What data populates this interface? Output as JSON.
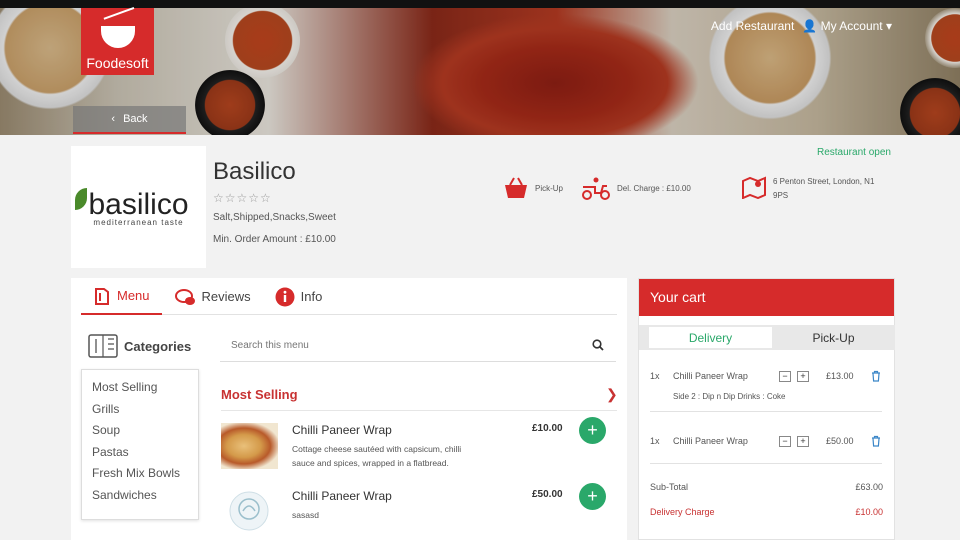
{
  "header": {
    "logo_text": "Foodesoft",
    "add_restaurant": "Add Restaurant",
    "my_account": "My Account",
    "back": "Back"
  },
  "restaurant": {
    "name": "Basilico",
    "logo_wordmark": "basilico",
    "logo_tagline": "mediterranean taste",
    "rating": 0,
    "stars": "☆☆☆☆☆",
    "cuisines": "Salt,Shipped,Snacks,Sweet",
    "min_order": "Min. Order Amount :  £10.00",
    "status": "Restaurant open",
    "pickup_label": "Pick-Up",
    "delivery_charge": "Del. Charge : £10.00",
    "address": "6 Penton Street, London, N1 9PS"
  },
  "tabs": [
    {
      "label": "Menu",
      "active": true
    },
    {
      "label": "Reviews",
      "active": false
    },
    {
      "label": "Info",
      "active": false
    }
  ],
  "categories": {
    "title": "Categories",
    "items": [
      "Most Selling",
      "Grills",
      "Soup",
      "Pastas",
      "Fresh Mix Bowls",
      "Sandwiches"
    ]
  },
  "search": {
    "placeholder": "Search this menu"
  },
  "section": {
    "title": "Most Selling"
  },
  "menu_items": [
    {
      "name": "Chilli Paneer Wrap",
      "description": "Cottage cheese sautéed with capsicum, chilli sauce and spices, wrapped in a flatbread.",
      "price": "£10.00",
      "add": "+"
    },
    {
      "name": "Chilli Paneer Wrap",
      "description": "sasasd",
      "price": "£50.00",
      "add": "+"
    }
  ],
  "cart": {
    "title": "Your cart",
    "tabs": [
      {
        "label": "Delivery",
        "active": true
      },
      {
        "label": "Pick-Up",
        "active": false
      }
    ],
    "items": [
      {
        "qty": "1x",
        "name": "Chilli Paneer Wrap",
        "price": "£13.00",
        "extras": "Side 2 : Dip n Dip Drinks : Coke",
        "minus": "−",
        "plus": "+"
      },
      {
        "qty": "1x",
        "name": "Chilli Paneer Wrap",
        "price": "£50.00",
        "extras": "",
        "minus": "−",
        "plus": "+"
      }
    ],
    "subtotal_label": "Sub-Total",
    "subtotal_value": "£63.00",
    "delivery_label": "Delivery Charge",
    "delivery_value": "£10.00"
  },
  "colors": {
    "brand_red": "#d62b2b",
    "accent_green": "#2aa86a"
  }
}
